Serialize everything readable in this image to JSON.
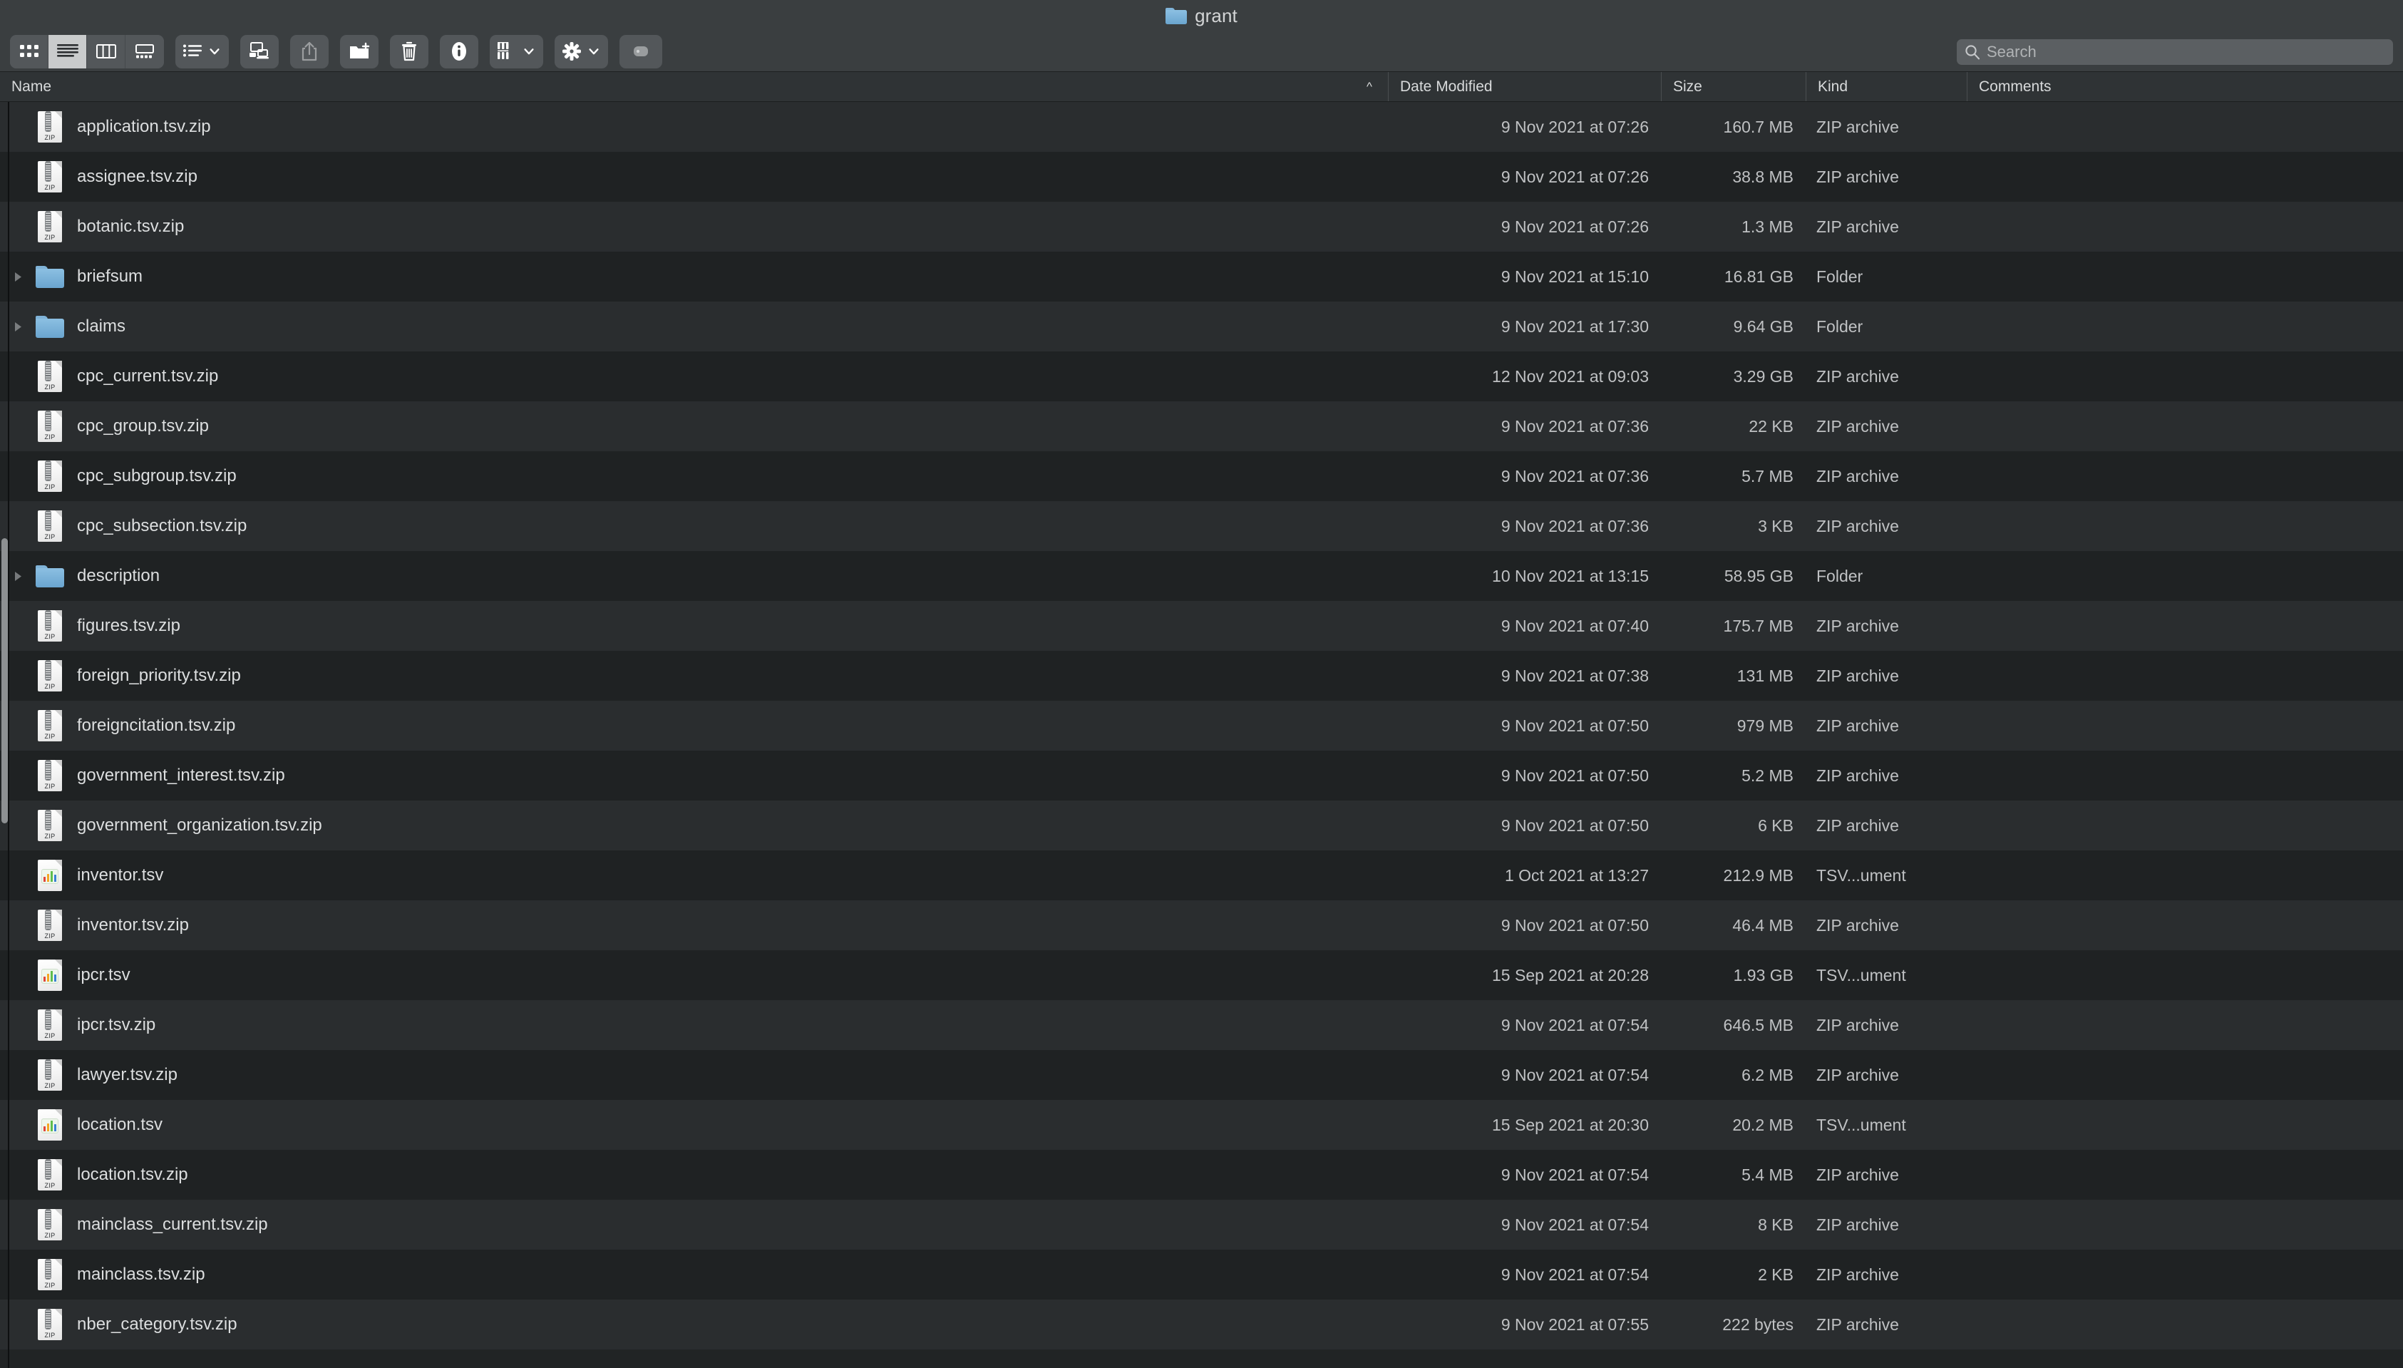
{
  "window": {
    "title": "grant",
    "title_icon": "folder-icon"
  },
  "toolbar": {
    "view_segments": [
      {
        "name": "icon-view",
        "icon": "grid-icon",
        "selected": false
      },
      {
        "name": "list-view",
        "icon": "list-lines-icon",
        "selected": true
      },
      {
        "name": "column-view",
        "icon": "columns-icon",
        "selected": false
      },
      {
        "name": "gallery-view",
        "icon": "gallery-icon",
        "selected": false
      }
    ],
    "group_button": {
      "name": "group-by",
      "icon": "bulleted-list-icon",
      "chevron": "chevron-down-icon"
    },
    "airdrop_button": {
      "name": "airdrop",
      "icon": "screens-icon"
    },
    "share_button": {
      "name": "share",
      "icon": "share-up-arrow-icon",
      "disabled": true
    },
    "new_folder_button": {
      "name": "new-folder",
      "icon": "folder-plus-icon"
    },
    "delete_button": {
      "name": "delete",
      "icon": "trash-icon"
    },
    "info_button": {
      "name": "get-info",
      "icon": "info-circle-icon"
    },
    "arrange_button": {
      "name": "arrange",
      "icon": "grid-columns-icon",
      "chevron": "chevron-down-icon"
    },
    "action_button": {
      "name": "action",
      "icon": "gear-icon",
      "chevron": "chevron-down-icon"
    },
    "tags_button": {
      "name": "tags",
      "icon": "tag-pill-icon"
    }
  },
  "search": {
    "placeholder": "Search",
    "value": "",
    "icon": "search-icon"
  },
  "columns": [
    {
      "key": "name",
      "label": "Name",
      "sort": "ascending",
      "sort_glyph": "^"
    },
    {
      "key": "date",
      "label": "Date Modified"
    },
    {
      "key": "size",
      "label": "Size"
    },
    {
      "key": "kind",
      "label": "Kind"
    },
    {
      "key": "comments",
      "label": "Comments"
    }
  ],
  "files": [
    {
      "name": "application.tsv.zip",
      "date": "9 Nov 2021 at 07:26",
      "size": "160.7 MB",
      "kind": "ZIP archive",
      "comments": "",
      "icon": "zip-icon",
      "expandable": false
    },
    {
      "name": "assignee.tsv.zip",
      "date": "9 Nov 2021 at 07:26",
      "size": "38.8 MB",
      "kind": "ZIP archive",
      "comments": "",
      "icon": "zip-icon",
      "expandable": false
    },
    {
      "name": "botanic.tsv.zip",
      "date": "9 Nov 2021 at 07:26",
      "size": "1.3 MB",
      "kind": "ZIP archive",
      "comments": "",
      "icon": "zip-icon",
      "expandable": false
    },
    {
      "name": "briefsum",
      "date": "9 Nov 2021 at 15:10",
      "size": "16.81 GB",
      "kind": "Folder",
      "comments": "",
      "icon": "folder-icon",
      "expandable": true
    },
    {
      "name": "claims",
      "date": "9 Nov 2021 at 17:30",
      "size": "9.64 GB",
      "kind": "Folder",
      "comments": "",
      "icon": "folder-icon",
      "expandable": true
    },
    {
      "name": "cpc_current.tsv.zip",
      "date": "12 Nov 2021 at 09:03",
      "size": "3.29 GB",
      "kind": "ZIP archive",
      "comments": "",
      "icon": "zip-icon",
      "expandable": false
    },
    {
      "name": "cpc_group.tsv.zip",
      "date": "9 Nov 2021 at 07:36",
      "size": "22 KB",
      "kind": "ZIP archive",
      "comments": "",
      "icon": "zip-icon",
      "expandable": false
    },
    {
      "name": "cpc_subgroup.tsv.zip",
      "date": "9 Nov 2021 at 07:36",
      "size": "5.7 MB",
      "kind": "ZIP archive",
      "comments": "",
      "icon": "zip-icon",
      "expandable": false
    },
    {
      "name": "cpc_subsection.tsv.zip",
      "date": "9 Nov 2021 at 07:36",
      "size": "3 KB",
      "kind": "ZIP archive",
      "comments": "",
      "icon": "zip-icon",
      "expandable": false
    },
    {
      "name": "description",
      "date": "10 Nov 2021 at 13:15",
      "size": "58.95 GB",
      "kind": "Folder",
      "comments": "",
      "icon": "folder-icon",
      "expandable": true
    },
    {
      "name": "figures.tsv.zip",
      "date": "9 Nov 2021 at 07:40",
      "size": "175.7 MB",
      "kind": "ZIP archive",
      "comments": "",
      "icon": "zip-icon",
      "expandable": false
    },
    {
      "name": "foreign_priority.tsv.zip",
      "date": "9 Nov 2021 at 07:38",
      "size": "131 MB",
      "kind": "ZIP archive",
      "comments": "",
      "icon": "zip-icon",
      "expandable": false
    },
    {
      "name": "foreigncitation.tsv.zip",
      "date": "9 Nov 2021 at 07:50",
      "size": "979 MB",
      "kind": "ZIP archive",
      "comments": "",
      "icon": "zip-icon",
      "expandable": false
    },
    {
      "name": "government_interest.tsv.zip",
      "date": "9 Nov 2021 at 07:50",
      "size": "5.2 MB",
      "kind": "ZIP archive",
      "comments": "",
      "icon": "zip-icon",
      "expandable": false
    },
    {
      "name": "government_organization.tsv.zip",
      "date": "9 Nov 2021 at 07:50",
      "size": "6 KB",
      "kind": "ZIP archive",
      "comments": "",
      "icon": "zip-icon",
      "expandable": false
    },
    {
      "name": "inventor.tsv",
      "date": "1 Oct 2021 at 13:27",
      "size": "212.9 MB",
      "kind": "TSV...ument",
      "comments": "",
      "icon": "tsv-icon",
      "expandable": false
    },
    {
      "name": "inventor.tsv.zip",
      "date": "9 Nov 2021 at 07:50",
      "size": "46.4 MB",
      "kind": "ZIP archive",
      "comments": "",
      "icon": "zip-icon",
      "expandable": false
    },
    {
      "name": "ipcr.tsv",
      "date": "15 Sep 2021 at 20:28",
      "size": "1.93 GB",
      "kind": "TSV...ument",
      "comments": "",
      "icon": "tsv-icon",
      "expandable": false
    },
    {
      "name": "ipcr.tsv.zip",
      "date": "9 Nov 2021 at 07:54",
      "size": "646.5 MB",
      "kind": "ZIP archive",
      "comments": "",
      "icon": "zip-icon",
      "expandable": false
    },
    {
      "name": "lawyer.tsv.zip",
      "date": "9 Nov 2021 at 07:54",
      "size": "6.2 MB",
      "kind": "ZIP archive",
      "comments": "",
      "icon": "zip-icon",
      "expandable": false
    },
    {
      "name": "location.tsv",
      "date": "15 Sep 2021 at 20:30",
      "size": "20.2 MB",
      "kind": "TSV...ument",
      "comments": "",
      "icon": "tsv-icon",
      "expandable": false
    },
    {
      "name": "location.tsv.zip",
      "date": "9 Nov 2021 at 07:54",
      "size": "5.4 MB",
      "kind": "ZIP archive",
      "comments": "",
      "icon": "zip-icon",
      "expandable": false
    },
    {
      "name": "mainclass_current.tsv.zip",
      "date": "9 Nov 2021 at 07:54",
      "size": "8 KB",
      "kind": "ZIP archive",
      "comments": "",
      "icon": "zip-icon",
      "expandable": false
    },
    {
      "name": "mainclass.tsv.zip",
      "date": "9 Nov 2021 at 07:54",
      "size": "2 KB",
      "kind": "ZIP archive",
      "comments": "",
      "icon": "zip-icon",
      "expandable": false
    },
    {
      "name": "nber_category.tsv.zip",
      "date": "9 Nov 2021 at 07:55",
      "size": "222 bytes",
      "kind": "ZIP archive",
      "comments": "",
      "icon": "zip-icon",
      "expandable": false
    }
  ],
  "colors": {
    "titlebar": "#3a3e40",
    "row_odd": "#2a2d2f",
    "row_even": "#1f2223",
    "folder_blue": "#7fb3d8",
    "text": "#c9cbcc"
  }
}
